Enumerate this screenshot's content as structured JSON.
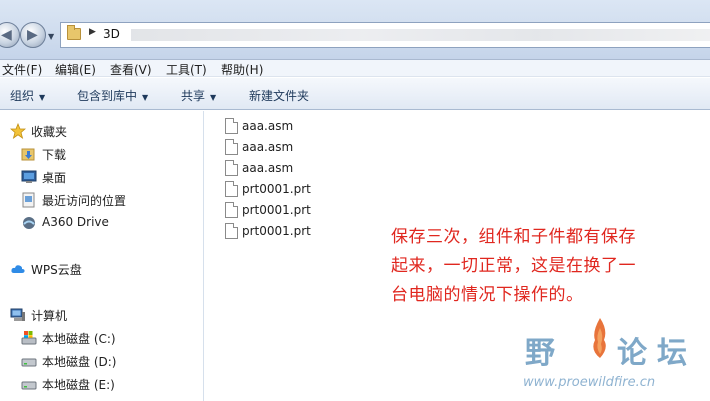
{
  "address_bar": {
    "path": "3D"
  },
  "menu": [
    {
      "label": "文件(F)"
    },
    {
      "label": "编辑(E)"
    },
    {
      "label": "查看(V)"
    },
    {
      "label": "工具(T)"
    },
    {
      "label": "帮助(H)"
    }
  ],
  "toolbar": {
    "organize": "组织",
    "include_in_library": "包含到库中",
    "share": "共享",
    "new_folder": "新建文件夹"
  },
  "sidebar": {
    "favorites": "收藏夹",
    "downloads": "下载",
    "desktop": "桌面",
    "recent": "最近访问的位置",
    "a360": "A360 Drive",
    "wps": "WPS云盘",
    "computer": "计算机",
    "drive_c": "本地磁盘 (C:)",
    "drive_d": "本地磁盘 (D:)",
    "drive_e": "本地磁盘 (E:)"
  },
  "files": [
    {
      "name": "aaa.asm"
    },
    {
      "name": "aaa.asm"
    },
    {
      "name": "aaa.asm"
    },
    {
      "name": "prt0001.prt"
    },
    {
      "name": "prt0001.prt"
    },
    {
      "name": "prt0001.prt"
    }
  ],
  "annotation": {
    "line1": "保存三次，组件和子件都有保存",
    "line2": "起来，一切正常，这是在换了一",
    "line3": "台电脑的情况下操作的。"
  },
  "watermark": {
    "c1": "野",
    "c2": "火",
    "c3": "论",
    "c4": "坛",
    "url": "www.proewildfire.cn"
  },
  "colors": {
    "annotation_text": "#e0271f",
    "watermark": "#7fa8c8",
    "flame": "#e8743b"
  }
}
